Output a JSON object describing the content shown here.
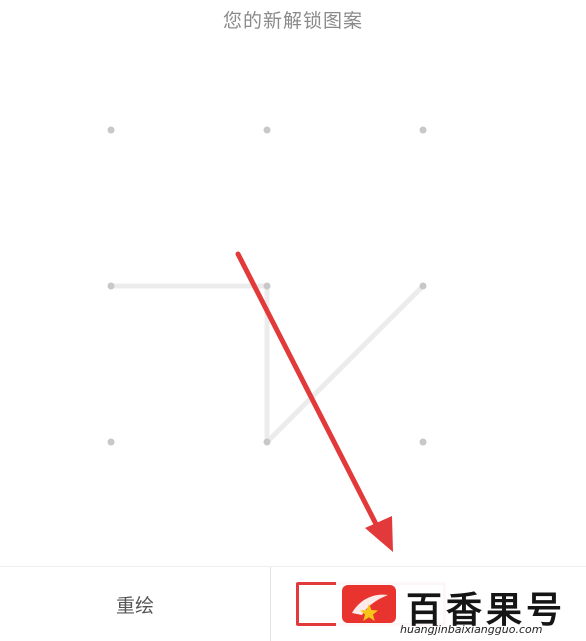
{
  "header": {
    "title": "您的新解锁图案"
  },
  "bottom_bar": {
    "redraw_label": "重绘",
    "confirm_label": ""
  },
  "pattern": {
    "dot_color": "#c8c8c8",
    "line_color": "#ececec",
    "drawn_sequence": [
      4,
      5,
      8,
      6
    ]
  },
  "annotation": {
    "arrow_color": "#e23a3a"
  },
  "watermark": {
    "brand": "百香果号",
    "url": "huangjinbaixiangguo.com",
    "badge_color": "#e8332f"
  }
}
